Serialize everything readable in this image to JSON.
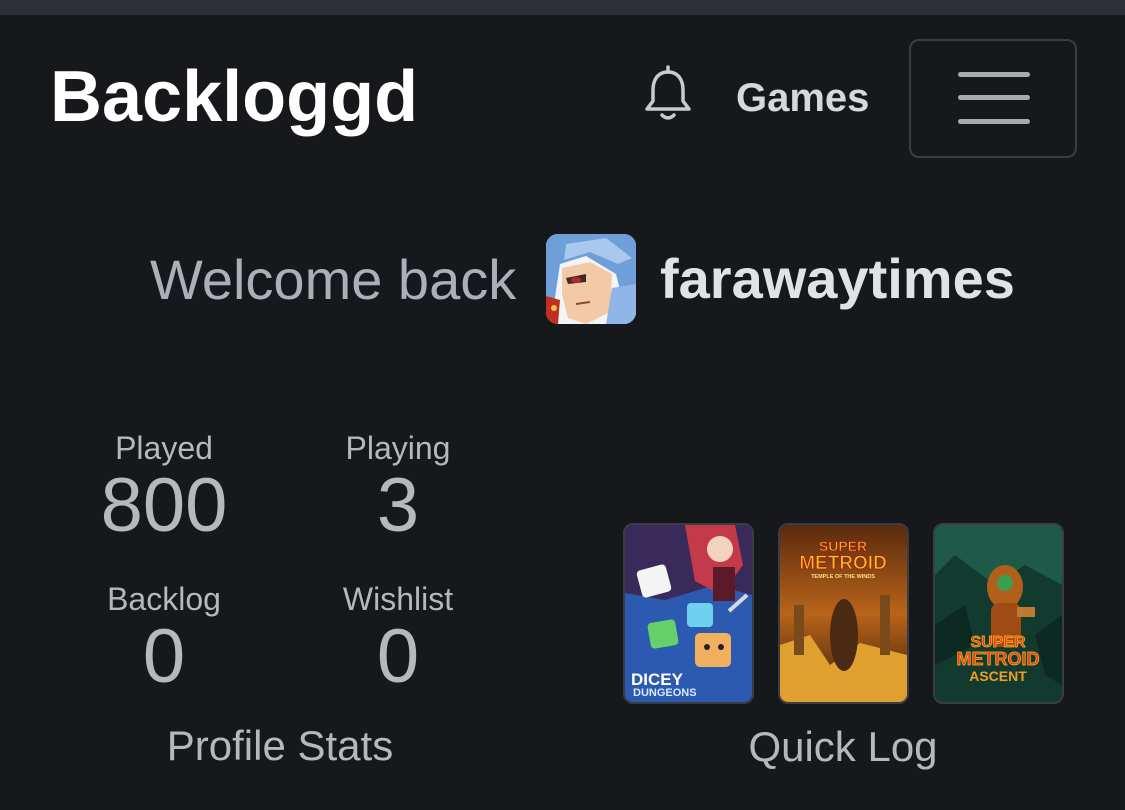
{
  "nav": {
    "brand": "Backloggd",
    "games_label": "Games",
    "bell_icon": "bell-icon",
    "menu_icon": "hamburger-icon"
  },
  "welcome": {
    "greeting": "Welcome back",
    "username": "farawaytimes"
  },
  "profile_stats": {
    "title": "Profile Stats",
    "items": [
      {
        "label": "Played",
        "value": "800"
      },
      {
        "label": "Playing",
        "value": "3"
      },
      {
        "label": "Backlog",
        "value": "0"
      },
      {
        "label": "Wishlist",
        "value": "0"
      }
    ]
  },
  "quick_log": {
    "title": "Quick Log",
    "games": [
      {
        "cover_text": [
          "DICEY",
          "DUNGEONS"
        ]
      },
      {
        "cover_text": [
          "SUPER",
          "METROID",
          "TEMPLE OF THE WINDS"
        ]
      },
      {
        "cover_text": [
          "SUPER",
          "METROID",
          "ASCENT"
        ]
      }
    ]
  },
  "colors": {
    "background": "#16181c",
    "text_muted": "#b5b8bd",
    "brand": "#ffffff"
  }
}
